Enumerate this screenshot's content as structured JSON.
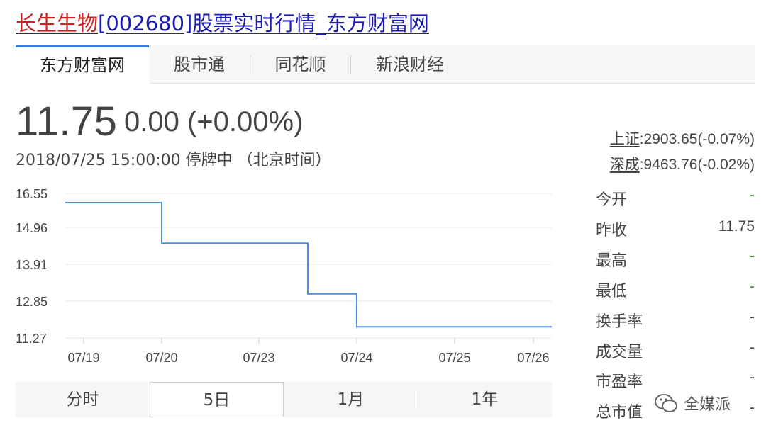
{
  "title": {
    "stock_name": "长生生物",
    "code_and_page": "[002680]股票实时行情_东方财富网"
  },
  "tabs": [
    {
      "label": "东方财富网",
      "active": true
    },
    {
      "label": "股市通",
      "active": false
    },
    {
      "label": "同花顺",
      "active": false
    },
    {
      "label": "新浪财经",
      "active": false
    }
  ],
  "quote": {
    "price": "11.75",
    "change": "0.00 (+0.00%)",
    "timestamp": "2018/07/25 15:00:00   停牌中  （北京时间）"
  },
  "indices": [
    {
      "name": "上证",
      "value": ":2903.65(-0.07%)"
    },
    {
      "name": "深成",
      "value": ":9463.76(-0.02%)"
    }
  ],
  "stats": [
    {
      "label": "今开",
      "value": "-"
    },
    {
      "label": "昨收",
      "value": "11.75"
    },
    {
      "label": "最高",
      "value": "-"
    },
    {
      "label": "最低",
      "value": "-"
    },
    {
      "label": "换手率",
      "value": "-"
    },
    {
      "label": "成交量",
      "value": "-"
    },
    {
      "label": "市盈率",
      "value": "-"
    },
    {
      "label": "总市值",
      "value": "-"
    }
  ],
  "range_buttons": [
    {
      "label": "分时",
      "active": false
    },
    {
      "label": "5日",
      "active": true
    },
    {
      "label": "1月",
      "active": false
    },
    {
      "label": "1年",
      "active": false
    }
  ],
  "watermark": "全媒派",
  "colors": {
    "line": "#4a8fe0",
    "grid": "#e8e8e8",
    "dash_value": "#4a8a3c",
    "tab_accent": "#3a7ed8",
    "title_red": "#cc2222",
    "title_blue": "#1a1ab4"
  },
  "chart_data": {
    "type": "line",
    "y_ticks": [
      "16.55",
      "14.96",
      "13.91",
      "12.85",
      "11.27"
    ],
    "x_ticks": [
      "07/19",
      "07/20",
      "07/23",
      "07/24",
      "07/25",
      "07/26"
    ],
    "series": [
      {
        "values": [
          {
            "x": "07/19",
            "y": 16.12
          },
          {
            "x": "07/20",
            "y": 16.12
          },
          {
            "x": "07/20",
            "y": 14.51
          },
          {
            "x": "07/23",
            "y": 14.51
          },
          {
            "x": "07/23",
            "y": 13.06
          },
          {
            "x": "07/24",
            "y": 13.06
          },
          {
            "x": "07/24",
            "y": 11.75
          },
          {
            "x": "07/26",
            "y": 11.75
          }
        ]
      }
    ]
  }
}
